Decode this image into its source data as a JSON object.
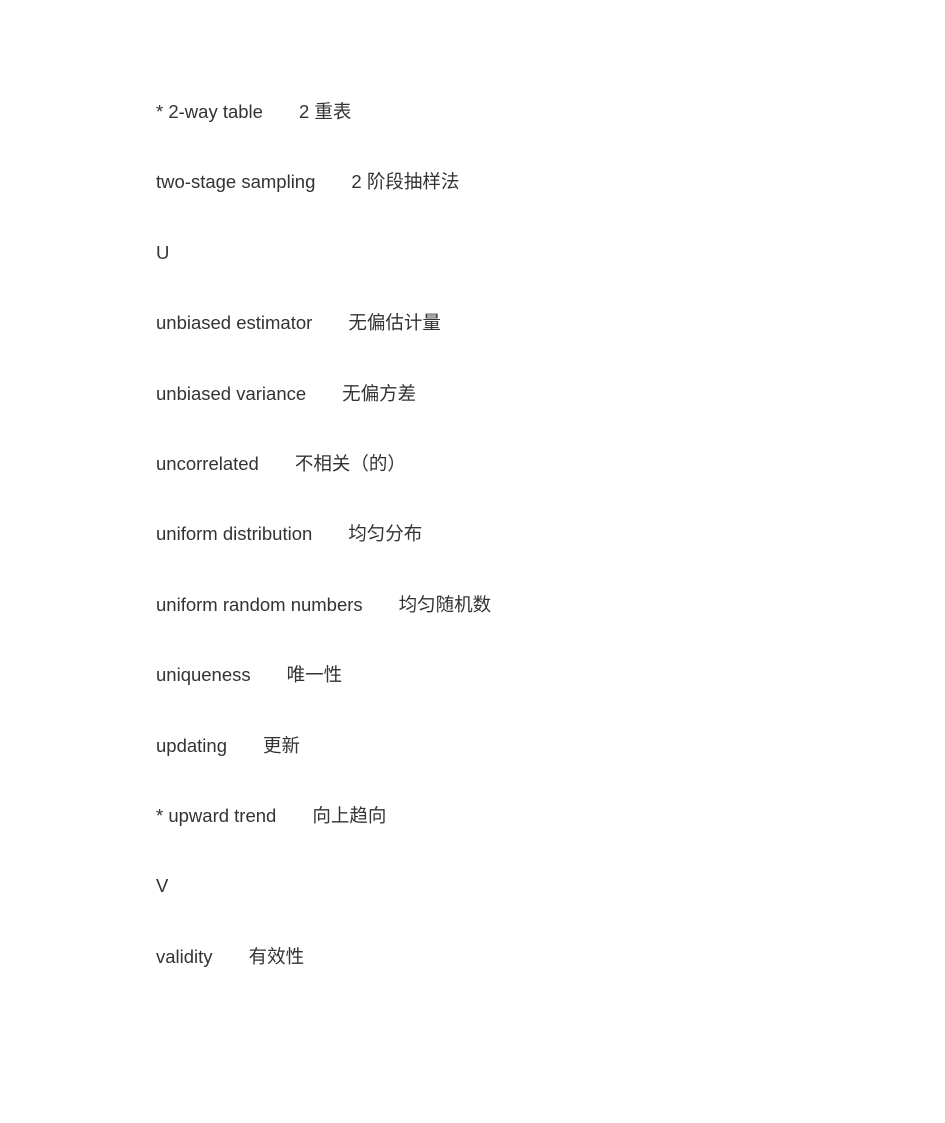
{
  "entries": [
    {
      "type": "term",
      "term": "* 2-way table",
      "translation": "2 重表"
    },
    {
      "type": "term",
      "term": "two-stage sampling",
      "translation": "2 阶段抽样法"
    },
    {
      "type": "letter",
      "term": "U",
      "translation": ""
    },
    {
      "type": "term",
      "term": "unbiased estimator",
      "translation": "无偏估计量"
    },
    {
      "type": "term",
      "term": "unbiased variance",
      "translation": "无偏方差"
    },
    {
      "type": "term",
      "term": "uncorrelated",
      "translation": "不相关（的）"
    },
    {
      "type": "term",
      "term": "uniform distribution",
      "translation": "均匀分布"
    },
    {
      "type": "term",
      "term": "uniform random numbers",
      "translation": "均匀随机数"
    },
    {
      "type": "term",
      "term": "uniqueness",
      "translation": "唯一性"
    },
    {
      "type": "term",
      "term": "updating",
      "translation": "更新"
    },
    {
      "type": "term",
      "term": "* upward trend",
      "translation": "向上趋向"
    },
    {
      "type": "letter",
      "term": "V",
      "translation": ""
    },
    {
      "type": "term",
      "term": "validity",
      "translation": "有效性"
    }
  ]
}
